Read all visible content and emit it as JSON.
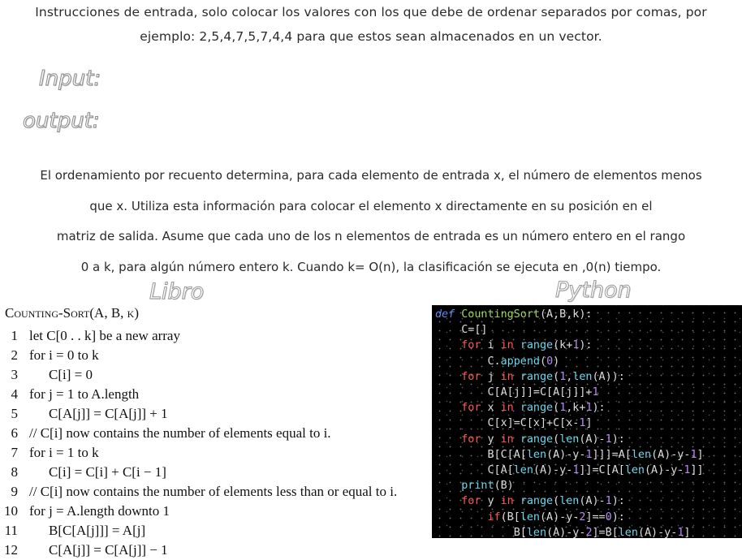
{
  "instructions": {
    "line1": "Instrucciones de entrada, solo colocar los valores con los que debe de ordenar separados por comas, por",
    "line2": "ejemplo: 2,5,4,7,5,7,4,4 para que estos sean almacenados en un vector."
  },
  "io": {
    "input_label": "Input:",
    "output_label": "output:",
    "input_value": "",
    "output_value": ""
  },
  "description": {
    "line1": "El ordenamiento por recuento determina, para cada elemento de entrada x, el número de elementos menos",
    "line2": "que x. Utiliza esta información para colocar el elemento x directamente en su posición en el",
    "line3": "matriz de salida. Asume que cada uno de los n elementos de entrada es un número entero en el rango",
    "line4": "0 a k, para algún número entero k. Cuando k= O(n), la clasificación se ejecuta en ,0(n) tiempo."
  },
  "headings": {
    "book": "Libro",
    "python": "Python"
  },
  "book": {
    "title": "Counting-Sort(A, B, k)",
    "lines": [
      {
        "n": "1",
        "text": "let C[0 . . k] be a new array"
      },
      {
        "n": "2",
        "text": "for i = 0 to k"
      },
      {
        "n": "3",
        "text": "C[i] = 0"
      },
      {
        "n": "4",
        "text": "for j = 1 to A.length"
      },
      {
        "n": "5",
        "text": "C[A[j]] = C[A[j]] + 1"
      },
      {
        "n": "6",
        "text": "// C[i] now contains the number of elements equal to i."
      },
      {
        "n": "7",
        "text": "for i = 1 to k"
      },
      {
        "n": "8",
        "text": "C[i] = C[i] + C[i − 1]"
      },
      {
        "n": "9",
        "text": "// C[i] now contains the number of elements less than or equal to i."
      },
      {
        "n": "10",
        "text": "for j = A.length downto 1"
      },
      {
        "n": "11",
        "text": "B[C[A[j]]] = A[j]"
      },
      {
        "n": "12",
        "text": "C[A[j]] = C[A[j]] − 1"
      }
    ]
  },
  "python": {
    "lines": [
      "def CountingSort(A,B,k):",
      "    C=[]",
      "    for i in range(k+1):",
      "        C.append(0)",
      "    for j in range(1,len(A)):",
      "        C[A[j]]=C[A[j]]+1",
      "    for x in range(1,k+1):",
      "        C[x]=C[x]+C[x-1]",
      "    for y in range(len(A)-1):",
      "        B[C[A[len(A)-y-1]]]=A[len(A)-y-1]",
      "        C[A[len(A)-y-1]]=C[A[len(A)-y-1]]",
      "    print(B)",
      "    for y in range(len(A)-1):",
      "        if(B[len(A)-y-2]==0):",
      "            B[len(A)-y-2]=B[len(A)-y-1]"
    ]
  }
}
